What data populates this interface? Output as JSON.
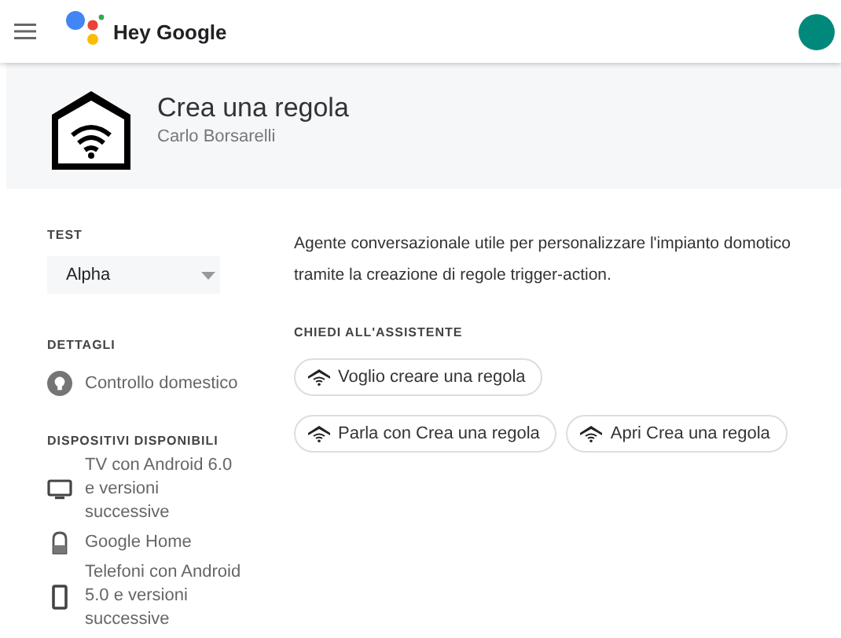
{
  "header": {
    "title": "Hey Google"
  },
  "action": {
    "title": "Crea una regola",
    "author": "Carlo Borsarelli"
  },
  "sidebar": {
    "test_label": "TEST",
    "version_select": {
      "value": "Alpha"
    },
    "details_label": "DETTAGLI",
    "category": "Controllo domestico",
    "devices_label": "DISPOSITIVI DISPONIBILI",
    "devices": [
      {
        "kind": "tv",
        "label": "TV con Android 6.0 e versioni successive"
      },
      {
        "kind": "speaker",
        "label": "Google Home"
      },
      {
        "kind": "phone",
        "label": "Telefoni con Android 5.0 e versioni successive"
      }
    ]
  },
  "description": "Agente conversazionale utile per personalizzare l'impianto domotico tramite la creazione di regole trigger-action.",
  "ask_label": "CHIEDI ALL'ASSISTENTE",
  "suggestion_rows": [
    [
      "Voglio creare una regola"
    ],
    [
      "Parla con Crea una regola",
      "Apri Crea una regola"
    ]
  ]
}
